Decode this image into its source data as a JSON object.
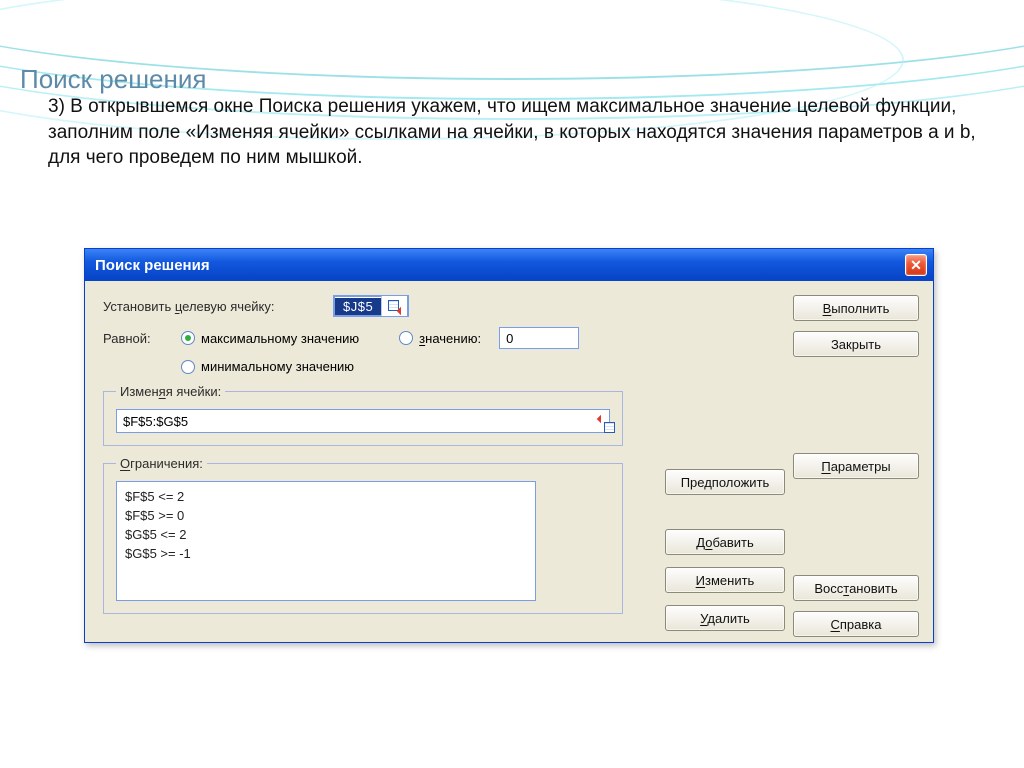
{
  "slide": {
    "title": "Поиск решения",
    "paragraph": "3) В открывшемся окне Поиска решения укажем, что ищем максимальное значение целевой функции, заполним поле «Изменяя ячейки» ссылками на ячейки, в которых находятся значения параметров a и b, для чего проведем по ним мышкой."
  },
  "dialog": {
    "title": "Поиск решения",
    "labels": {
      "set_target": "Установить целевую ячейку:",
      "equal_to": "Равной:",
      "radio_max": "максимальному значению",
      "radio_min": "минимальному значению",
      "radio_value": "значению:",
      "changing_legend": "Изменяя ячейки:",
      "constraints_legend": "Ограничения:"
    },
    "values": {
      "target_cell": "$J$5",
      "value_input": "0",
      "changing_cells": "$F$5:$G$5",
      "constraints": [
        "$F$5 <= 2",
        "$F$5 >= 0",
        "$G$5 <= 2",
        "$G$5 >= -1"
      ]
    },
    "buttons": {
      "execute": "Выполнить",
      "close": "Закрыть",
      "suggest": "Предположить",
      "params": "Параметры",
      "add": "Добавить",
      "change": "Изменить",
      "delete": "Удалить",
      "restore": "Восстановить",
      "help": "Справка"
    }
  }
}
